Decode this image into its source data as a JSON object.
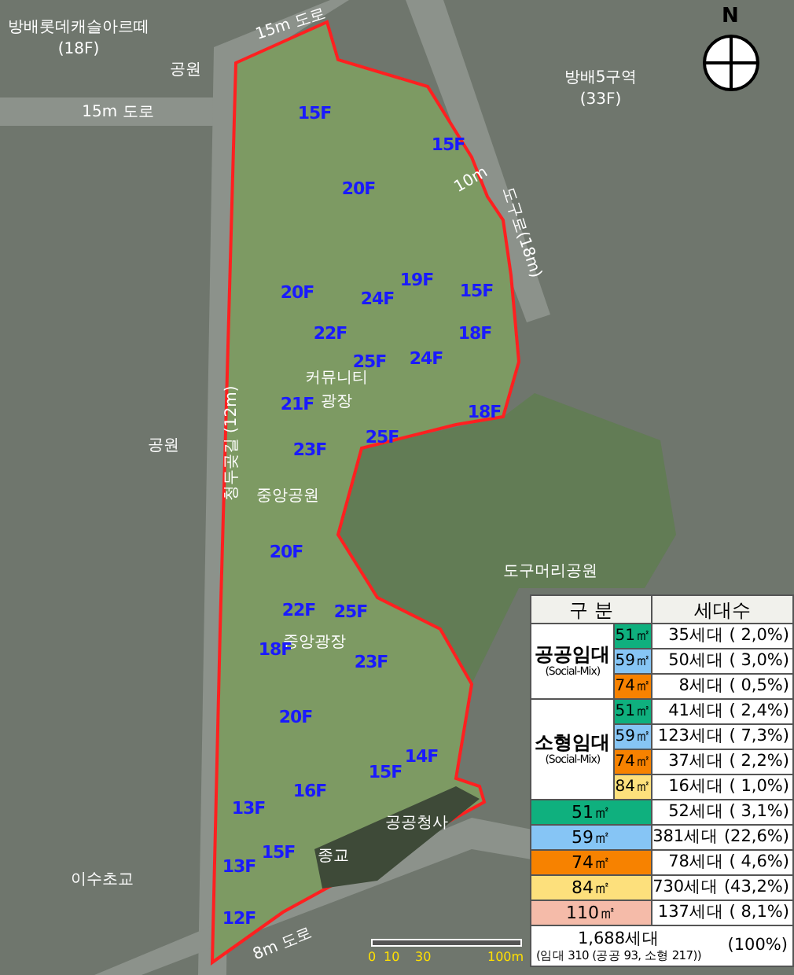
{
  "map": {
    "place_labels": [
      "방배롯데캐슬아르떼",
      "(18F)",
      "공원",
      "방배5구역",
      "(33F)",
      "커뮤니티",
      "광장",
      "공원",
      "중앙공원",
      "도구머리공원",
      "중앙광장",
      "공공청사",
      "종교",
      "이수초교"
    ],
    "road_labels": [
      "15m 도로",
      "15m 도로",
      "10m",
      "도구로(18m)",
      "청두곶길 (12m)",
      "8m 도로"
    ],
    "floor_labels": [
      "15F",
      "15F",
      "20F",
      "20F",
      "24F",
      "19F",
      "15F",
      "18F",
      "22F",
      "25F",
      "24F",
      "21F",
      "23F",
      "25F",
      "18F",
      "20F",
      "22F",
      "25F",
      "18F",
      "23F",
      "20F",
      "14F",
      "15F",
      "16F",
      "13F",
      "15F",
      "13F",
      "12F"
    ],
    "scale_labels": [
      "0",
      "10",
      "30",
      "100m"
    ],
    "compass_label": "N"
  },
  "legend": {
    "headers": [
      "구 분",
      "세대수"
    ],
    "groups": [
      {
        "name": "공공임대",
        "note": "(Social-Mix)",
        "rows": [
          {
            "size": "51㎡",
            "color": "#0fb07e",
            "count": "35세대 ( 2,0%)"
          },
          {
            "size": "59㎡",
            "color": "#86c5f5",
            "count": "50세대 ( 3,0%)"
          },
          {
            "size": "74㎡",
            "color": "#f78200",
            "count": "8세대 ( 0,5%)"
          }
        ]
      },
      {
        "name": "소형임대",
        "note": "(Social-Mix)",
        "rows": [
          {
            "size": "51㎡",
            "color": "#0fb07e",
            "count": "41세대 ( 2,4%)"
          },
          {
            "size": "59㎡",
            "color": "#86c5f5",
            "count": "123세대 ( 7,3%)"
          },
          {
            "size": "74㎡",
            "color": "#f78200",
            "count": "37세대 ( 2,2%)"
          },
          {
            "size": "84㎡",
            "color": "#fde07c",
            "count": "16세대 ( 1,0%)"
          }
        ]
      }
    ],
    "totals": [
      {
        "size": "51㎡",
        "color": "#0fb07e",
        "count": "52세대 ( 3,1%)"
      },
      {
        "size": "59㎡",
        "color": "#86c5f5",
        "count": "381세대 (22,6%)"
      },
      {
        "size": "74㎡",
        "color": "#f78200",
        "count": "78세대 ( 4,6%)"
      },
      {
        "size": "84㎡",
        "color": "#fde07c",
        "count": "730세대 (43,2%)"
      },
      {
        "size": "110㎡",
        "color": "#f5bba9",
        "count": "137세대 ( 8,1%)"
      }
    ],
    "grand_total": {
      "count": "1,688세대",
      "breakdown": "(임대 310 (공공 93, 소형 217))",
      "percent": "(100%)"
    }
  }
}
